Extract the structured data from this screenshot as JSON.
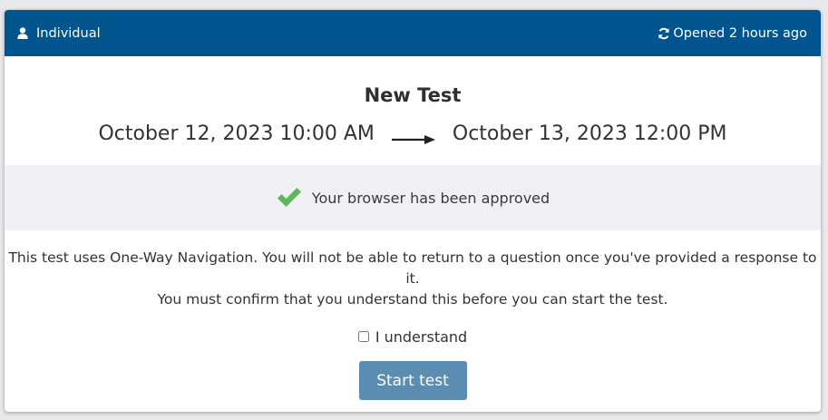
{
  "header": {
    "type_label": "Individual",
    "type_icon": "user-icon",
    "status_label": "Opened 2 hours ago",
    "status_icon": "refresh-icon",
    "background_color": "#00558f"
  },
  "test": {
    "title": "New Test",
    "start": "October 12, 2023 10:00 AM",
    "end": "October 13, 2023 12:00 PM",
    "arrow_icon": "arrow-right-icon"
  },
  "approval": {
    "message": "Your browser has been approved",
    "icon": "check-icon",
    "icon_color": "#5cb85c"
  },
  "navigation_notice": {
    "line1": "This test uses One-Way Navigation. You will not be able to return to a question once you've provided a response to it.",
    "line2": "You must confirm that you understand this before you can start the test."
  },
  "confirm": {
    "label": "I understand",
    "checked": false
  },
  "start_button": {
    "label": "Start test",
    "color": "#5b8db3"
  }
}
